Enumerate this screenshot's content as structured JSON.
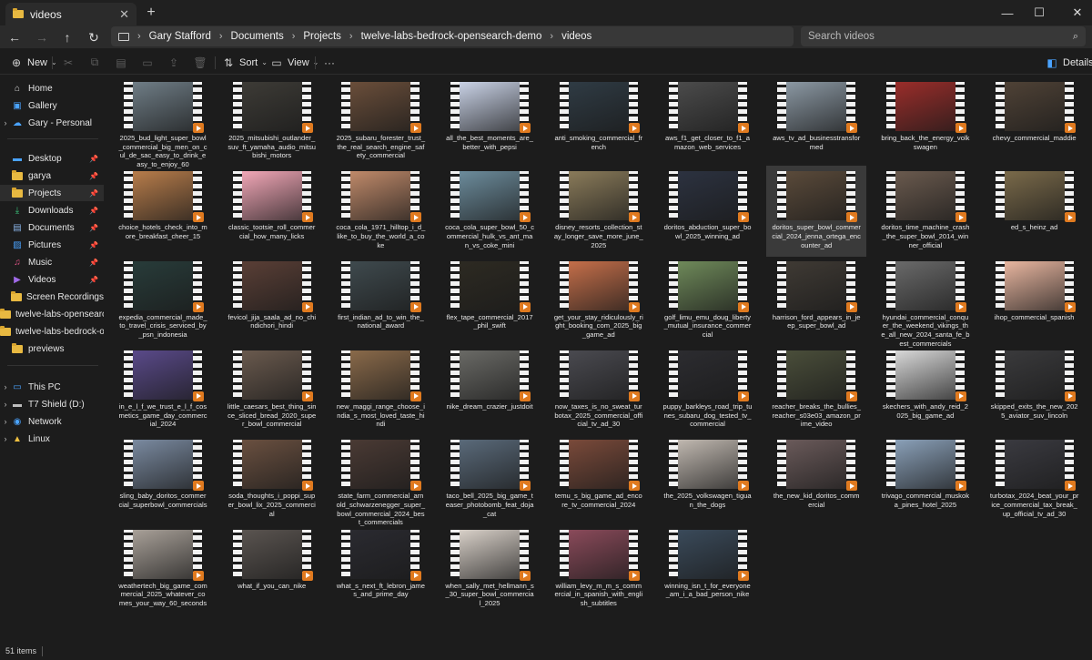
{
  "window": {
    "tab_title": "videos",
    "new_tab_label": "+",
    "close_tab": "✕",
    "minimize": "—",
    "maximize": "☐",
    "close": "✕"
  },
  "address": {
    "crumbs": [
      "Gary Stafford",
      "Documents",
      "Projects",
      "twelve-labs-bedrock-opensearch-demo",
      "videos"
    ],
    "search_placeholder": "Search videos"
  },
  "commandbar": {
    "new_label": "New",
    "sort_label": "Sort",
    "view_label": "View",
    "more_label": "···",
    "details_label": "Details"
  },
  "sidebar": {
    "items": [
      {
        "label": "Home",
        "icon": "home-icon"
      },
      {
        "label": "Gallery",
        "icon": "gallery-icon"
      },
      {
        "label": "Gary - Personal",
        "icon": "onedrive-icon"
      },
      {
        "label": "Desktop",
        "icon": "desktop-icon"
      },
      {
        "label": "garya",
        "icon": "folder-icon"
      },
      {
        "label": "Projects",
        "icon": "folder-icon"
      },
      {
        "label": "Downloads",
        "icon": "downloads-icon"
      },
      {
        "label": "Documents",
        "icon": "documents-icon"
      },
      {
        "label": "Pictures",
        "icon": "pictures-icon"
      },
      {
        "label": "Music",
        "icon": "music-icon"
      },
      {
        "label": "Videos",
        "icon": "videos-icon"
      },
      {
        "label": "Screen Recordings",
        "icon": "folder-icon"
      },
      {
        "label": "twelve-labs-opensearch-",
        "icon": "folder-icon"
      },
      {
        "label": "twelve-labs-bedrock-ope",
        "icon": "folder-icon"
      },
      {
        "label": "previews",
        "icon": "folder-icon"
      },
      {
        "label": "This PC",
        "icon": "this-pc-icon"
      },
      {
        "label": "T7 Shield (D:)",
        "icon": "drive-icon"
      },
      {
        "label": "Network",
        "icon": "network-icon"
      },
      {
        "label": "Linux",
        "icon": "linux-icon"
      }
    ]
  },
  "files": [
    {
      "name": "2025_bud_light_super_bowl_commercial_big_men_on_cul_de_sac_easy_to_drink_easy_to_enjoy_60",
      "color": "#6f7d86"
    },
    {
      "name": "2025_mitsubishi_outlander_suv_ft_yamaha_audio_mitsubishi_motors",
      "color": "#3d3b36"
    },
    {
      "name": "2025_subaru_forester_trust_the_real_search_engine_safety_commercial",
      "color": "#6a4e3a"
    },
    {
      "name": "all_the_best_moments_are_better_with_pepsi",
      "color": "#c9d2e6"
    },
    {
      "name": "anti_smoking_commercial_french",
      "color": "#2f3b44"
    },
    {
      "name": "aws_f1_get_closer_to_f1_amazon_web_services",
      "color": "#4b4b4b"
    },
    {
      "name": "aws_tv_ad_businesstransformed",
      "color": "#8b98a3"
    },
    {
      "name": "bring_back_the_energy_volkswagen",
      "color": "#9a2d2a"
    },
    {
      "name": "chevy_commercial_maddie",
      "color": "#4f4236"
    },
    {
      "name": "choice_hotels_check_into_more_breakfast_cheer_15",
      "color": "#b87d4b"
    },
    {
      "name": "classic_tootsie_roll_commercial_how_many_licks",
      "color": "#f2a7b7"
    },
    {
      "name": "coca_cola_1971_hilltop_i_d_like_to_buy_the_world_a_coke",
      "color": "#c08a6a"
    },
    {
      "name": "coca_cola_super_bowl_50_commercial_hulk_vs_ant_man_vs_coke_mini",
      "color": "#6c8c9c"
    },
    {
      "name": "disney_resorts_collection_stay_longer_save_more_june_2025",
      "color": "#8a7b5a"
    },
    {
      "name": "doritos_abduction_super_bowl_2025_winning_ad",
      "color": "#2c3240"
    },
    {
      "name": "doritos_super_bowl_commercial_2024_jenna_ortega_encounter_ad",
      "color": "#5a4a3a",
      "selected": true
    },
    {
      "name": "doritos_time_machine_crash_the_super_bowl_2014_winner_official",
      "color": "#6a5a4e"
    },
    {
      "name": "ed_s_heinz_ad",
      "color": "#7a6a4a"
    },
    {
      "name": "expedia_commercial_made_to_travel_crisis_serviced_by_psn_indonesia",
      "color": "#283c3a"
    },
    {
      "name": "fevicol_jija_saala_ad_no_chindichori_hindi",
      "color": "#5a3f36"
    },
    {
      "name": "first_indian_ad_to_win_the_national_award",
      "color": "#3f4a4e"
    },
    {
      "name": "flex_tape_commercial_2017_phil_swift",
      "color": "#2d2a22"
    },
    {
      "name": "get_your_stay_ridiculously_right_booking_com_2025_big_game_ad",
      "color": "#c56f4a"
    },
    {
      "name": "golf_limu_emu_doug_liberty_mutual_insurance_commercial",
      "color": "#6f8a5a"
    },
    {
      "name": "harrison_ford_appears_in_jeep_super_bowl_ad",
      "color": "#3f3a34"
    },
    {
      "name": "hyundai_commercial_conquer_the_weekend_vikings_the_all_new_2024_santa_fe_best_commercials",
      "color": "#6a6a6a"
    },
    {
      "name": "ihop_commercial_spanish",
      "color": "#e8b6a0"
    },
    {
      "name": "in_e_l_f_we_trust_e_l_f_cosmetics_game_day_commercial_2024",
      "color": "#5a4a8a"
    },
    {
      "name": "little_caesars_best_thing_since_sliced_bread_2020_super_bowl_commercial",
      "color": "#6a5a4e"
    },
    {
      "name": "new_maggi_range_choose_india_s_most_loved_taste_hindi",
      "color": "#8a6a4a"
    },
    {
      "name": "nike_dream_crazier_justdoit",
      "color": "#6a6a66"
    },
    {
      "name": "now_taxes_is_no_sweat_turbotax_2025_commercial_official_tv_ad_30",
      "color": "#4a4a50"
    },
    {
      "name": "puppy_barkleys_road_trip_tunes_subaru_dog_tested_tv_commercial",
      "color": "#2c2c30"
    },
    {
      "name": "reacher_breaks_the_bullies_reacher_s03e03_amazon_prime_video",
      "color": "#4a4e3a"
    },
    {
      "name": "skechers_with_andy_reid_2025_big_game_ad",
      "color": "#d8d8d8"
    },
    {
      "name": "skipped_exits_the_new_2025_aviator_suv_lincoln",
      "color": "#3a3a3c"
    },
    {
      "name": "sling_baby_doritos_commercial_superbowl_commercials",
      "color": "#7a8aa0"
    },
    {
      "name": "soda_thoughts_i_poppi_super_bowl_lix_2025_commercial",
      "color": "#6a5040"
    },
    {
      "name": "state_farm_commercial_arnold_schwarzenegger_super_bowl_commercial_2024_best_commercials",
      "color": "#4a3a34"
    },
    {
      "name": "taco_bell_2025_big_game_teaser_photobomb_feat_doja_cat",
      "color": "#5a6a7a"
    },
    {
      "name": "temu_s_big_game_ad_encore_tv_commercial_2024",
      "color": "#7a4a3a"
    },
    {
      "name": "the_2025_volkswagen_tiguan_the_dogs",
      "color": "#c0b8b0"
    },
    {
      "name": "the_new_kid_doritos_commercial",
      "color": "#6a5a5a"
    },
    {
      "name": "trivago_commercial_muskoka_pines_hotel_2025",
      "color": "#8aa0b8"
    },
    {
      "name": "turbotax_2024_beat_your_price_commercial_tax_break_up_official_tv_ad_30",
      "color": "#3a3a40"
    },
    {
      "name": "weathertech_big_game_commercial_2025_whatever_comes_your_way_60_seconds",
      "color": "#a8a098"
    },
    {
      "name": "what_if_you_can_nike",
      "color": "#5a5450"
    },
    {
      "name": "what_s_next_ft_lebron_james_and_prime_day",
      "color": "#2a2a30"
    },
    {
      "name": "when_sally_met_hellmann_s_30_super_bowl_commercial_2025",
      "color": "#d8d0c8"
    },
    {
      "name": "william_levy_m_m_s_commercial_in_spanish_with_english_subtitles",
      "color": "#8a4a5a"
    },
    {
      "name": "winning_isn_t_for_everyone_am_i_a_bad_person_nike",
      "color": "#3a4a5a"
    }
  ],
  "status": {
    "item_count": "51 items"
  },
  "colors": {
    "play_badge": "#e07a1f",
    "folder": "#e8b941",
    "selected_tile": "#3a3a3a"
  }
}
